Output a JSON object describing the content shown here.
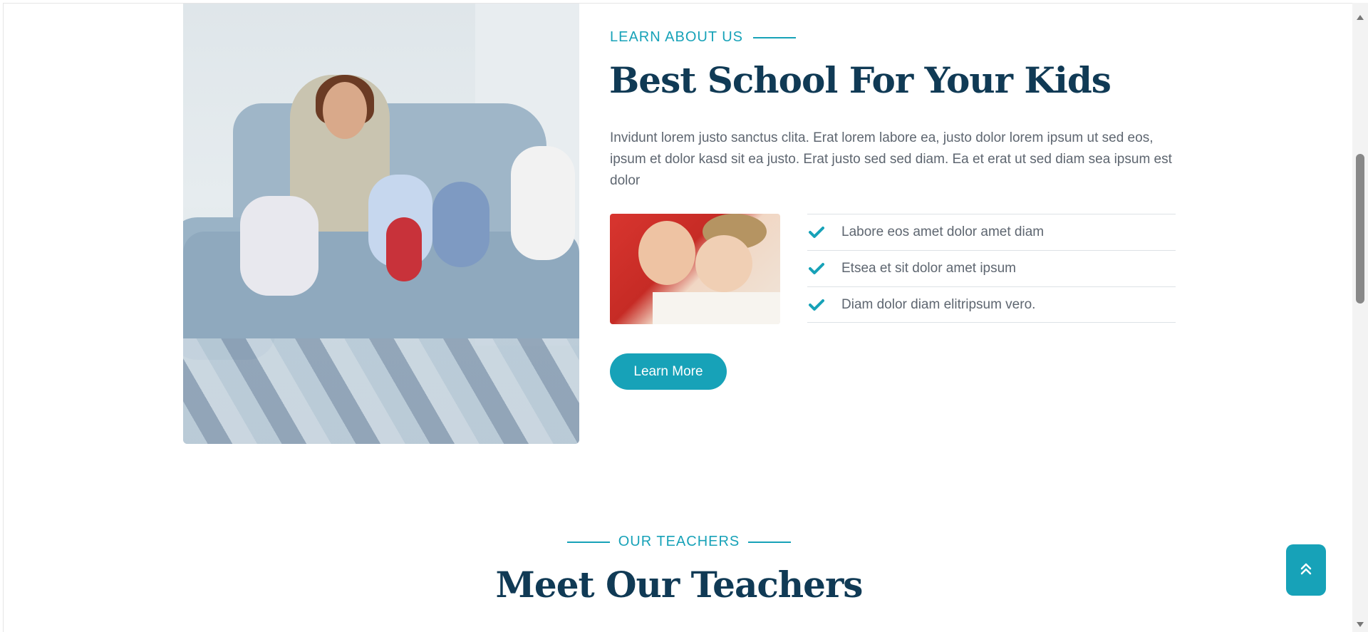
{
  "about": {
    "eyebrow": "LEARN ABOUT US",
    "title": "Best School For Your Kids",
    "description": "Invidunt lorem justo sanctus clita. Erat lorem labore ea, justo dolor lorem ipsum ut sed eos, ipsum et dolor kasd sit ea justo. Erat justo sed sed diam. Ea et erat ut sed diam sea ipsum est dolor",
    "checklist": [
      "Labore eos amet dolor amet diam",
      "Etsea et sit dolor amet ipsum",
      "Diam dolor diam elitripsum vero."
    ],
    "button_label": "Learn More"
  },
  "teachers": {
    "eyebrow": "OUR TEACHERS",
    "title": "Meet Our Teachers"
  },
  "icons": {
    "check": "check-icon",
    "back_to_top": "double-chevron-up-icon"
  },
  "colors": {
    "accent": "#17a2b8",
    "heading": "#103a55",
    "body_text": "#5e6670"
  }
}
